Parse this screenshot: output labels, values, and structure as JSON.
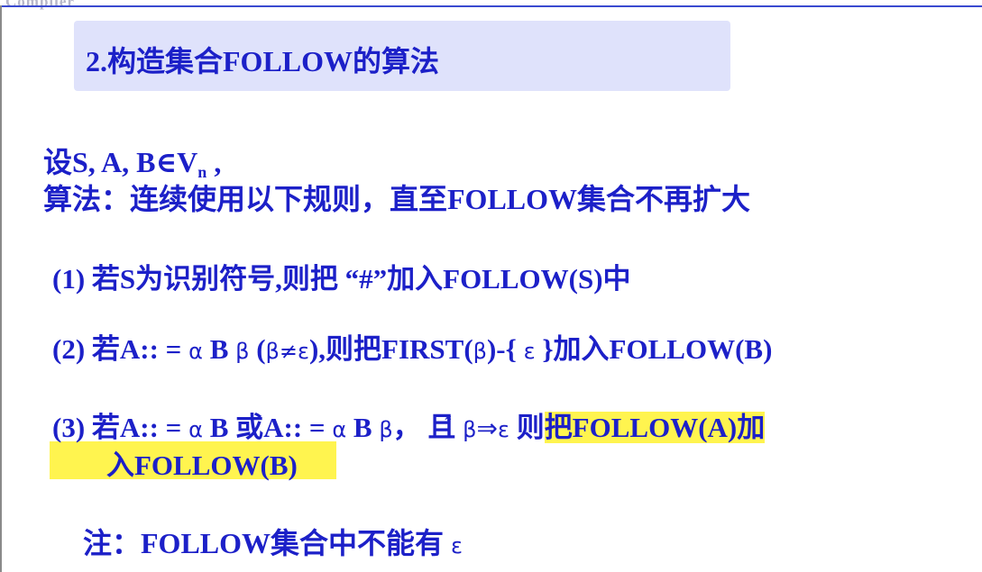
{
  "logo_text": "Compiler",
  "title": "2.构造集合FOLLOW的算法",
  "intro": {
    "line1_prefix": "设S, A, B∈V",
    "line1_sub": "n",
    "line1_suffix": " ,",
    "line2": "算法：连续使用以下规则，直至FOLLOW集合不再扩大"
  },
  "rules": {
    "r1": "(1)  若S为识别符号,则把 “#”加入FOLLOW(S)中",
    "r2_a": "(2)  若A:: = ",
    "r2_alpha": "α",
    "r2_b": " B ",
    "r2_beta": "β",
    "r2_c": "  (",
    "r2_beta2": "β",
    "r2_ne": "≠",
    "r2_eps": "ε",
    "r2_d": "),则把FIRST(",
    "r2_beta3": "β",
    "r2_e": ")-{ ",
    "r2_eps2": "ε",
    "r2_f": " }加入FOLLOW(B)",
    "r3_a": "(3)  若A:: = ",
    "r3_alpha": "α",
    "r3_b": " B 或A:: = ",
    "r3_alpha2": "α",
    "r3_c": " B ",
    "r3_beta": "β",
    "r3_d": "，  且 ",
    "r3_beta2": "β",
    "r3_star": "*",
    "r3_arrow": "⇒",
    "r3_eps": "ε",
    "r3_e": " 则",
    "r3_hl1": "把FOLLOW(A)加",
    "r3_hl2": "入FOLLOW(B)"
  },
  "note": {
    "text": "注：FOLLOW集合中不能有 ",
    "eps": "ε"
  },
  "colors": {
    "text": "#1c20c8",
    "title_bg": "#dfe2fb",
    "highlight": "#fff44f"
  }
}
